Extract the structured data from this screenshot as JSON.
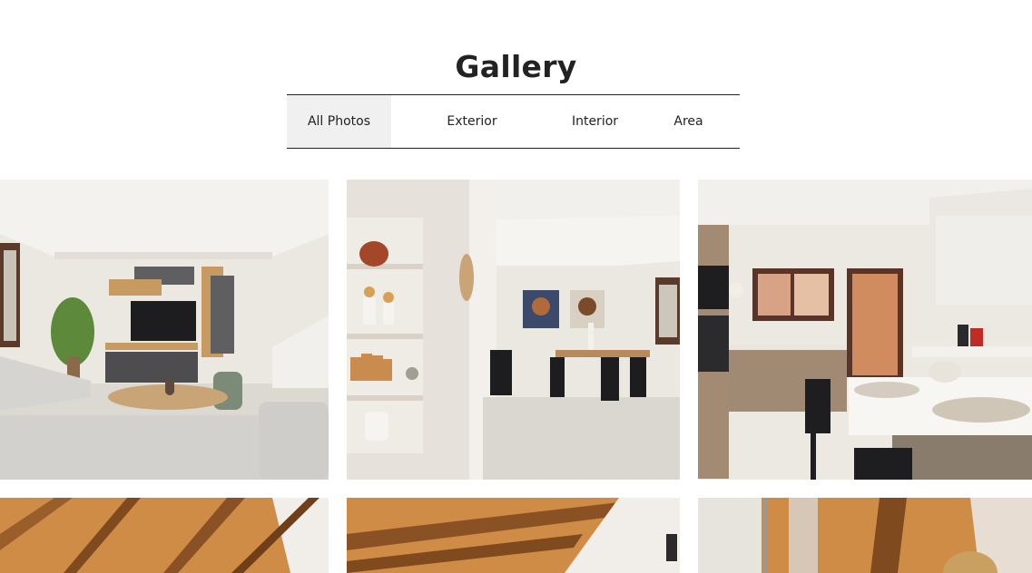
{
  "page": {
    "title": "Gallery"
  },
  "filters": {
    "active": "All Photos",
    "items": [
      {
        "label": "All Photos"
      },
      {
        "label": "Exterior"
      },
      {
        "label": "Interior"
      },
      {
        "label": "Area"
      }
    ]
  },
  "colors": {
    "text": "#222222",
    "active_tab_bg": "#f0f0f0",
    "wall": "#ece8e2",
    "wood": "#b8763a"
  }
}
